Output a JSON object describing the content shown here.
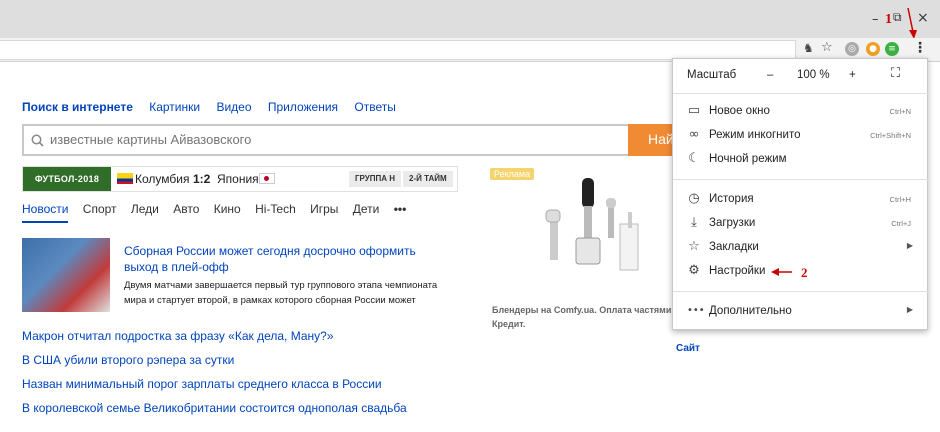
{
  "window": {
    "minimize_icon": "–",
    "restore_icon": "⧉",
    "close_icon": "×"
  },
  "annotations": {
    "one": "1",
    "two": "2"
  },
  "search": {
    "tabs": [
      "Поиск в интернете",
      "Картинки",
      "Видео",
      "Приложения",
      "Ответы"
    ],
    "placeholder": "известные картины Айвазовского",
    "button": "Найти"
  },
  "football": {
    "badge": "ФУТБОЛ-2018",
    "team1": "Колумбия",
    "score": "1:2",
    "team2": "Япония",
    "group": "ГРУППА H",
    "half": "2-Й ТАЙМ"
  },
  "news_tabs": [
    "Новости",
    "Спорт",
    "Леди",
    "Авто",
    "Кино",
    "Hi-Tech",
    "Игры",
    "Дети",
    "•••"
  ],
  "main_news": {
    "headline": "Сборная России может сегодня досрочно оформить выход в плей-офф",
    "snippet": "Двумя матчами завершается первый тур группового этапа чемпионата мира и стартует второй, в рамках которого сборная России может"
  },
  "news_links": [
    "Макрон отчитал подростка за фразу «Как дела, Ману?»",
    "В США убили второго рэпера за сутки",
    "Назван минимальный порог зарплаты среднего класса в России",
    "В королевской семье Великобритании состоится однополая свадьба"
  ],
  "ad": {
    "badge": "Реклама",
    "caption": "Блендеры на Comfy.ua. Оплата частями Кредит.",
    "site": "Сайт"
  },
  "menu": {
    "zoom_label": "Масштаб",
    "zoom_minus": "–",
    "zoom_value": "100 %",
    "zoom_plus": "+",
    "items": [
      {
        "label": "Новое окно",
        "shortcut": "Ctrl+N"
      },
      {
        "label": "Режим инкогнито",
        "shortcut": "Ctrl+Shift+N"
      },
      {
        "label": "Ночной режим",
        "shortcut": ""
      },
      {
        "label": "История",
        "shortcut": "Ctrl+H"
      },
      {
        "label": "Загрузки",
        "shortcut": "Ctrl+J"
      },
      {
        "label": "Закладки",
        "shortcut": ""
      },
      {
        "label": "Настройки",
        "shortcut": ""
      },
      {
        "label": "Дополнительно",
        "shortcut": ""
      }
    ]
  },
  "colors": {
    "accent_link": "#0044bb",
    "search_button": "#f08a33",
    "football_badge": "#2f6d28",
    "annotation": "#cc0000"
  }
}
